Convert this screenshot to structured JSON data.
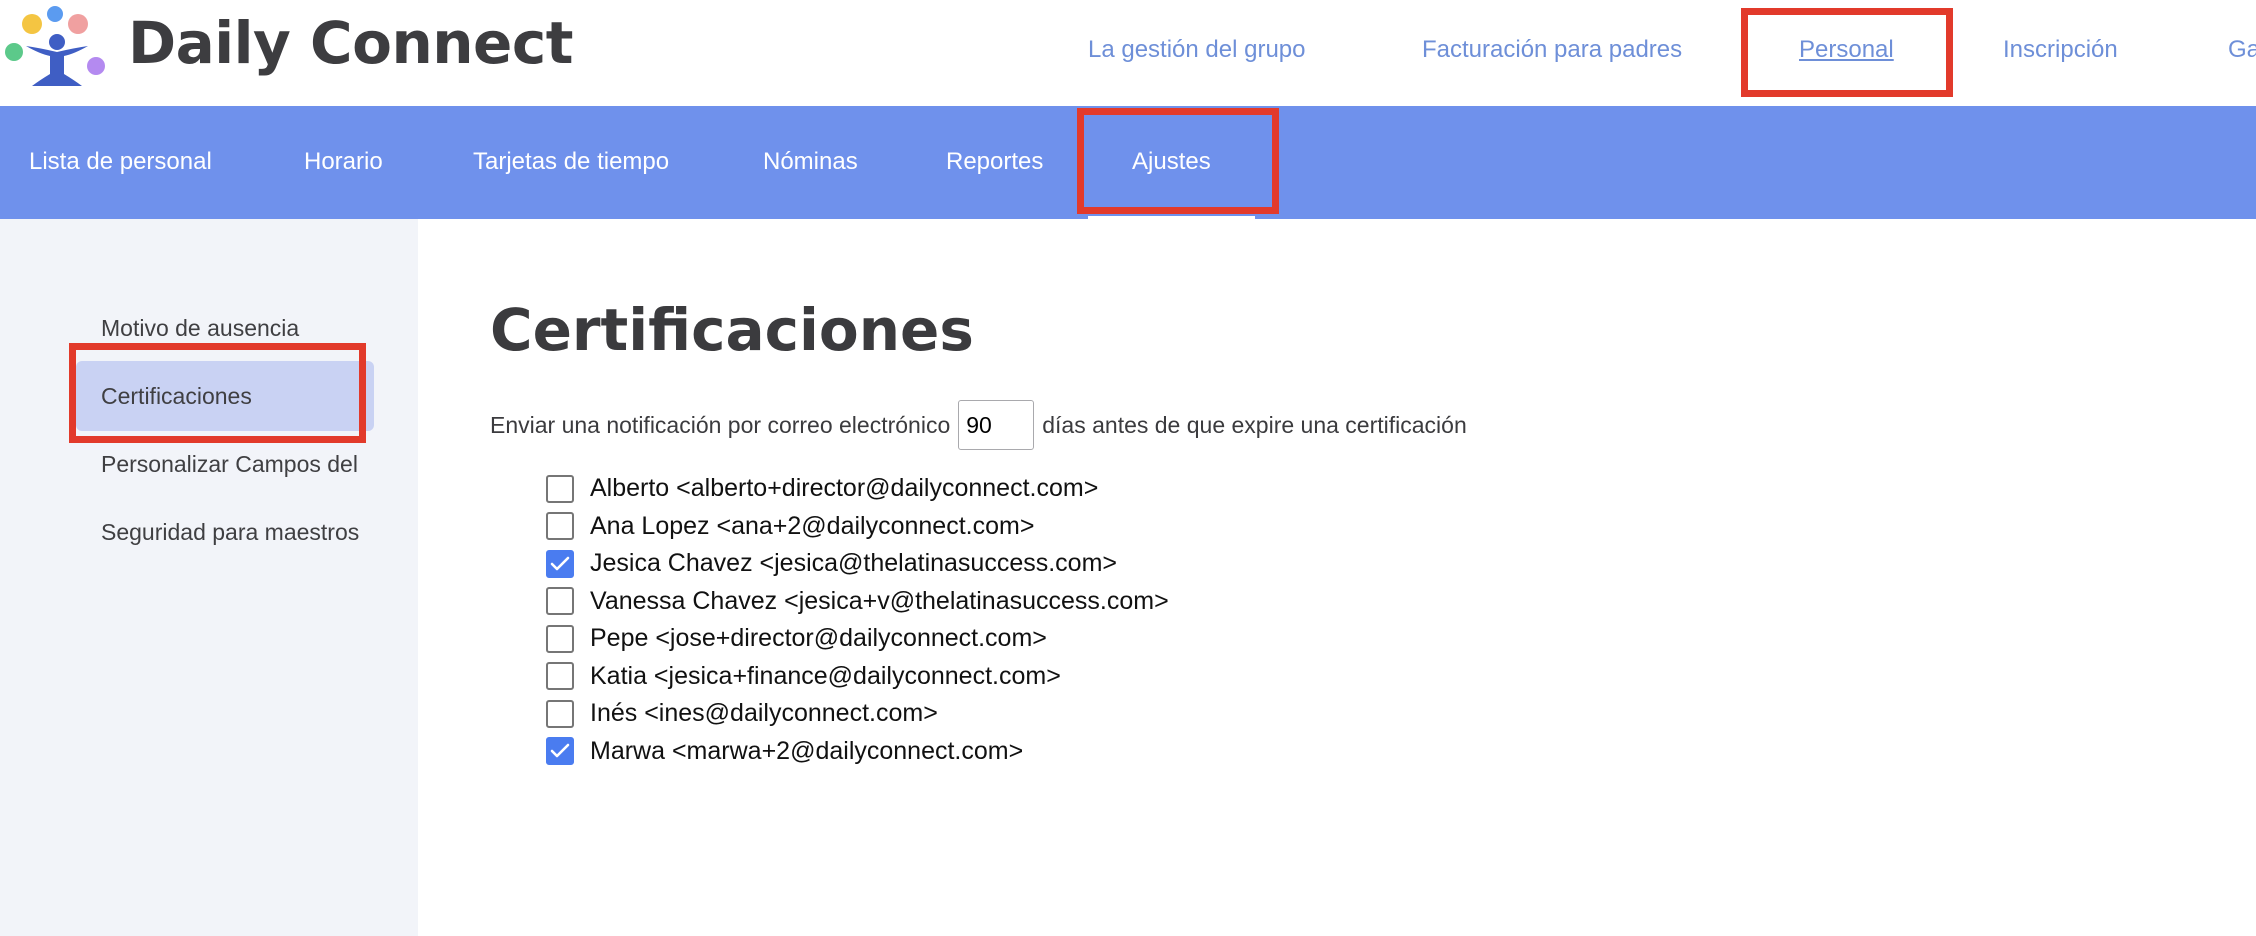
{
  "brand": {
    "name": "Daily Connect",
    "logo_icon": "daily-connect-logo-icon"
  },
  "top_nav": {
    "items": [
      {
        "label": "La gestión del grupo"
      },
      {
        "label": "Facturación para padres"
      },
      {
        "label": "Personal"
      },
      {
        "label": "Inscripción"
      },
      {
        "label": "Ga"
      }
    ],
    "active": "Personal"
  },
  "sub_nav": {
    "items": [
      {
        "label": "Lista de personal"
      },
      {
        "label": "Horario"
      },
      {
        "label": "Tarjetas de tiempo"
      },
      {
        "label": "Nóminas"
      },
      {
        "label": "Reportes"
      },
      {
        "label": "Ajustes"
      }
    ],
    "active": "Ajustes"
  },
  "sidebar": {
    "items": [
      {
        "label": "Motivo de ausencia"
      },
      {
        "label": "Certificaciones"
      },
      {
        "label": "Personalizar Campos del"
      },
      {
        "label": "Seguridad para maestros"
      }
    ],
    "active": "Certificaciones"
  },
  "main": {
    "title": "Certificaciones",
    "notify_prefix": "Enviar una notificación por correo electrónico",
    "notify_days": "90",
    "notify_suffix": "días antes de que expire una certificación",
    "recipients": [
      {
        "label": "Alberto <alberto+director@dailyconnect.com>",
        "checked": false
      },
      {
        "label": "Ana Lopez <ana+2@dailyconnect.com>",
        "checked": false
      },
      {
        "label": "Jesica Chavez <jesica@thelatinasuccess.com>",
        "checked": true
      },
      {
        "label": "Vanessa Chavez <jesica+v@thelatinasuccess.com>",
        "checked": false
      },
      {
        "label": "Pepe <jose+director@dailyconnect.com>",
        "checked": false
      },
      {
        "label": "Katia <jesica+finance@dailyconnect.com>",
        "checked": false
      },
      {
        "label": "Inés <ines@dailyconnect.com>",
        "checked": false
      },
      {
        "label": "Marwa <marwa+2@dailyconnect.com>",
        "checked": true
      }
    ]
  },
  "colors": {
    "accent": "#6f91ec",
    "top_nav_link": "#6e8fd8",
    "highlight": "#e23a2b",
    "sidebar_bg": "#f2f4f9",
    "sidebar_active": "#c9d2f3",
    "checkbox_checked": "#4a7cf0"
  }
}
